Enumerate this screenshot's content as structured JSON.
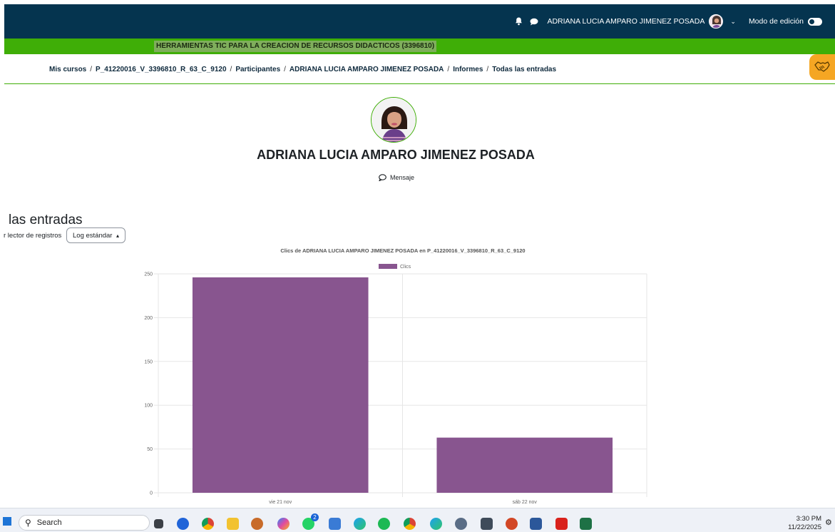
{
  "navbar": {
    "user_name": "ADRIANA LUCIA AMPARO JIMENEZ POSADA",
    "edit_mode_label": "Modo de edición"
  },
  "course": {
    "title": "HERRAMIENTAS TIC PARA LA CREACION DE RECURSOS DIDACTICOS (3396810)"
  },
  "breadcrumb": {
    "items": [
      "Mis cursos",
      "P_41220016_V_3396810_R_63_C_9120",
      "Participantes",
      "ADRIANA LUCIA AMPARO JIMENEZ POSADA",
      "Informes",
      "Todas las entradas"
    ]
  },
  "profile": {
    "name": "ADRIANA LUCIA AMPARO JIMENEZ POSADA",
    "message_label": "Mensaje"
  },
  "page": {
    "heading": "las entradas",
    "reader_label": "r lector de registros",
    "log_select_value": "Log estándar"
  },
  "chart_data": {
    "type": "bar",
    "title": "Clics de ADRIANA LUCIA AMPARO JIMENEZ POSADA  en P_41220016_V_3396810_R_63_C_9120",
    "categories": [
      "vie 21 nov",
      "sáb 22 nov"
    ],
    "series": [
      {
        "name": "Clics",
        "values": [
          246,
          63
        ],
        "color": "#88558f"
      }
    ],
    "ylim": [
      0,
      250
    ],
    "yticks": [
      0,
      50,
      100,
      150,
      200,
      250
    ],
    "grid": true,
    "legend": "top-center"
  },
  "taskbar": {
    "search_placeholder": "Search",
    "time": "3:30 PM",
    "date": "11/22/2025",
    "badge_count": "2"
  },
  "colors": {
    "navbar": "#05344f",
    "course_bar": "#3fae07",
    "help_button": "#f5a623",
    "bar": "#88558f"
  }
}
